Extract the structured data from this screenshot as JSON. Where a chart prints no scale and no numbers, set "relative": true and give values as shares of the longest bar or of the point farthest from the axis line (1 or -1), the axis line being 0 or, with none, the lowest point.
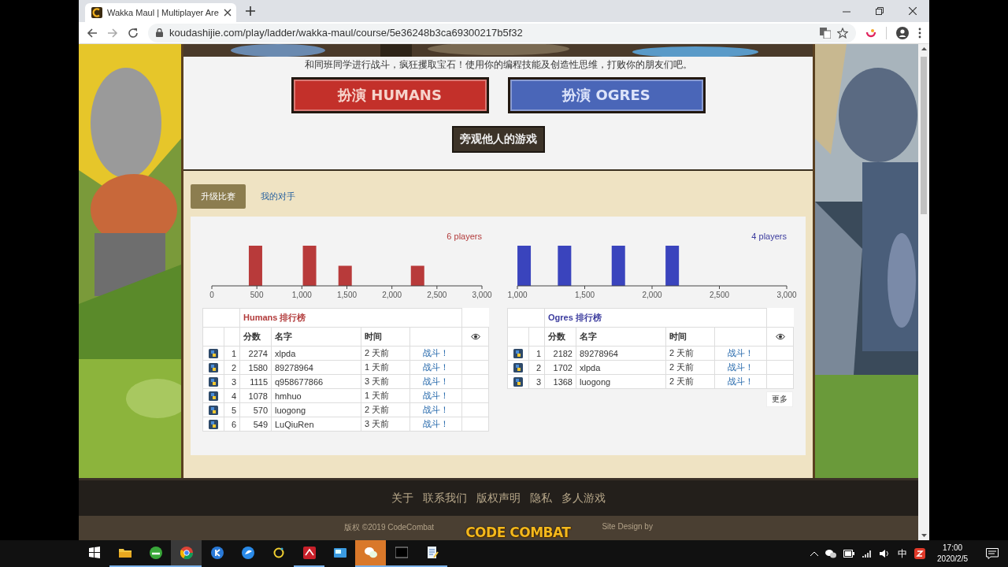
{
  "browser": {
    "tab_title": "Wakka Maul | Multiplayer Are",
    "url": "koudashijie.com/play/ladder/wakka-maul/course/5e36248b3ca69300217b5f32"
  },
  "page": {
    "intro": "和同班同学进行战斗，疯狂攫取宝石！使用你的编程技能及创造性思维，打败你的朋友们吧。",
    "play_buttons": [
      {
        "kind": "red",
        "label": "扮演 HUMANS"
      },
      {
        "kind": "blue",
        "label": "扮演 OGRES"
      }
    ],
    "spectate_button": "旁观他人的游戏",
    "tabs": [
      {
        "label": "升级比赛",
        "selected": true
      },
      {
        "label": "我的对手",
        "selected": false
      }
    ],
    "ladders": [
      {
        "color": "#b23b3b",
        "chart_data": {
          "type": "bar",
          "relative": true,
          "title": "6 players",
          "x": [
            485,
            1085,
            1480,
            2285
          ],
          "series": [
            {
              "color": "#b83a3a",
              "values": [
                1,
                1,
                0.5,
                0.5
              ]
            }
          ],
          "xlim": [
            0,
            3000
          ],
          "xticks": [
            {
              "value": 0,
              "label": "0"
            },
            {
              "value": 500,
              "label": "500"
            },
            {
              "value": 1000,
              "label": "1,000"
            },
            {
              "value": 1500,
              "label": "1,500"
            },
            {
              "value": 2000,
              "label": "2,000"
            },
            {
              "value": 2500,
              "label": "2,500"
            },
            {
              "value": 3000,
              "label": "3,000"
            }
          ]
        },
        "title": "Humans 排行榜",
        "columns": [
          "分数",
          "名字",
          "时间"
        ],
        "rows": [
          {
            "rank": "1",
            "score": "2274",
            "name": "xlpda",
            "time": "2 天前",
            "action": "战斗！"
          },
          {
            "rank": "2",
            "score": "1580",
            "name": "89278964",
            "time": "1 天前",
            "action": "战斗！"
          },
          {
            "rank": "3",
            "score": "1115",
            "name": "q958677866",
            "time": "3 天前",
            "action": "战斗！"
          },
          {
            "rank": "4",
            "score": "1078",
            "name": "hmhuo",
            "time": "1 天前",
            "action": "战斗！"
          },
          {
            "rank": "5",
            "score": "570",
            "name": "luogong",
            "time": "2 天前",
            "action": "战斗！"
          },
          {
            "rank": "6",
            "score": "549",
            "name": "LuQiuRen",
            "time": "3 天前",
            "action": "战斗！"
          }
        ]
      },
      {
        "color": "#3b3b9e",
        "chart_data": {
          "type": "bar",
          "relative": true,
          "title": "4 players",
          "x": [
            1050,
            1350,
            1750,
            2150
          ],
          "series": [
            {
              "color": "#3a44bd",
              "values": [
                1,
                1,
                1,
                1
              ]
            }
          ],
          "xlim": [
            1000,
            3000
          ],
          "xticks": [
            {
              "value": 1000,
              "label": "1,000"
            },
            {
              "value": 1500,
              "label": "1,500"
            },
            {
              "value": 2000,
              "label": "2,000"
            },
            {
              "value": 2500,
              "label": "2,500"
            },
            {
              "value": 3000,
              "label": "3,000"
            }
          ]
        },
        "title": "Ogres 排行榜",
        "columns": [
          "分数",
          "名字",
          "时间"
        ],
        "rows": [
          {
            "rank": "1",
            "score": "2182",
            "name": "89278964",
            "time": "2 天前",
            "action": "战斗！"
          },
          {
            "rank": "2",
            "score": "1702",
            "name": "xlpda",
            "time": "2 天前",
            "action": "战斗！"
          },
          {
            "rank": "3",
            "score": "1368",
            "name": "luogong",
            "time": "2 天前",
            "action": "战斗！"
          }
        ],
        "more_button": "更多"
      }
    ],
    "footer": {
      "links": [
        "关于",
        "联系我们",
        "版权声明",
        "隐私",
        "多人游戏"
      ],
      "copyright": "版权 ©2019 CodeCombat",
      "logo": "CODE COMBAT",
      "credit": "Site Design by"
    }
  },
  "taskbar": {
    "ime": "中",
    "time": "17:00",
    "date": "2020/2/5"
  }
}
